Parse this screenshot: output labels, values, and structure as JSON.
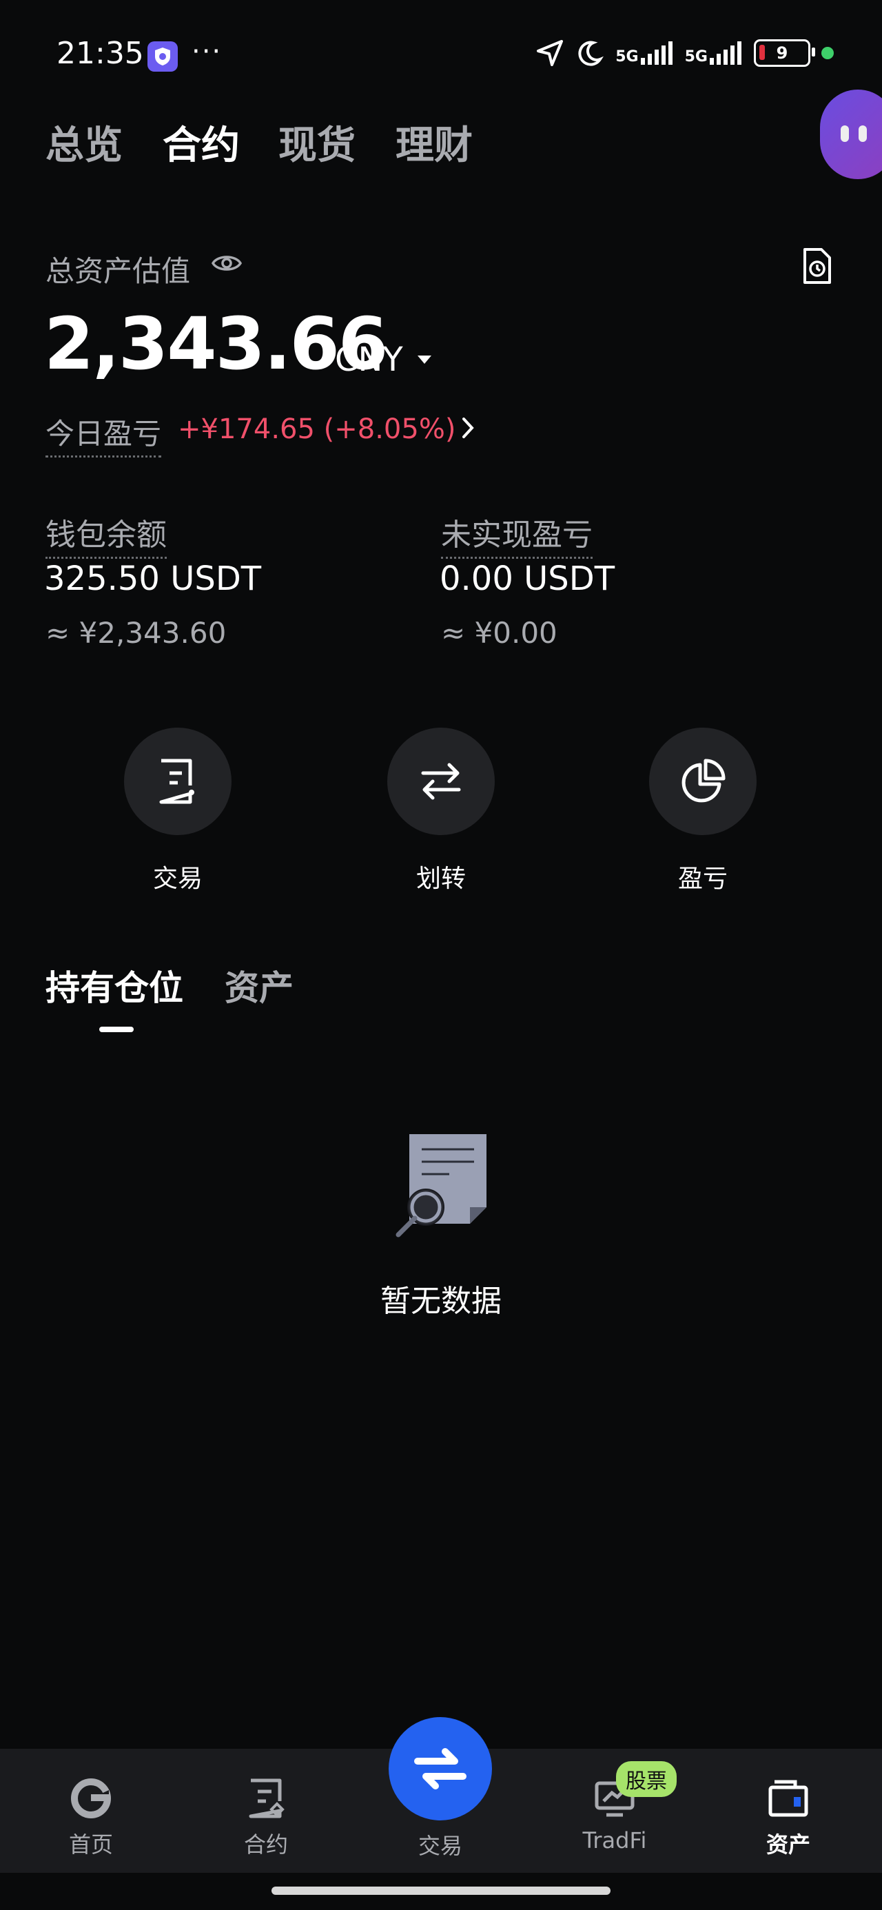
{
  "status": {
    "time": "21:35",
    "dots": "···",
    "signal1": "5G",
    "signal2": "5G",
    "battery": "9"
  },
  "top_tabs": [
    "总览",
    "合约",
    "现货",
    "理财"
  ],
  "asset": {
    "label": "总资产估值",
    "amount": "2,343.66",
    "currency": "CNY",
    "today_label": "今日盈亏",
    "today_value": "+¥174.65 (+8.05%)"
  },
  "wallet": {
    "label": "钱包余额",
    "value": "325.50 USDT",
    "sub": "≈ ¥2,343.60"
  },
  "unrealized": {
    "label": "未实现盈亏",
    "value": "0.00 USDT",
    "sub": "≈ ¥0.00"
  },
  "actions": [
    "交易",
    "划转",
    "盈亏"
  ],
  "section_tabs": [
    "持有仓位",
    "资产"
  ],
  "empty_text": "暂无数据",
  "bottom_nav": {
    "home": "首页",
    "contract": "合约",
    "trade": "交易",
    "tradfi": "TradFi",
    "assets": "资产",
    "stock_badge": "股票"
  },
  "colors": {
    "accent": "#2462f0",
    "profit": "#f0506a",
    "badge": "#a6e36a"
  }
}
